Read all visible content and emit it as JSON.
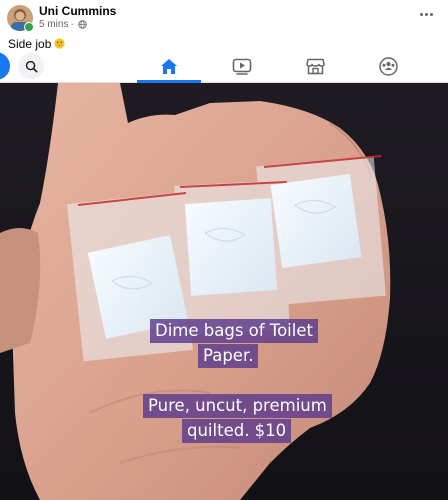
{
  "post": {
    "author": "Uni Cummins",
    "time": "5 mins",
    "separator": "·",
    "privacy_icon": "globe-icon",
    "caption": "Side job",
    "caption_emoji": "grinning-face-emoji",
    "more_icon": "more-horizontal-icon"
  },
  "nav": {
    "logo_icon": "facebook-logo-icon",
    "search_icon": "search-icon",
    "tabs": [
      {
        "id": "home",
        "icon": "home-icon",
        "active": true
      },
      {
        "id": "watch",
        "icon": "video-icon",
        "active": false
      },
      {
        "id": "marketplace",
        "icon": "marketplace-icon",
        "active": false
      },
      {
        "id": "groups",
        "icon": "groups-icon",
        "active": false
      }
    ],
    "active_color": "#1877f2",
    "inactive_color": "#65676b"
  },
  "media": {
    "overlay_lines": [
      "Dime bags of Toilet",
      "Paper.",
      "Pure, uncut, premium",
      "quilted. $10"
    ],
    "overlay_bg": "#5c3a8c"
  }
}
